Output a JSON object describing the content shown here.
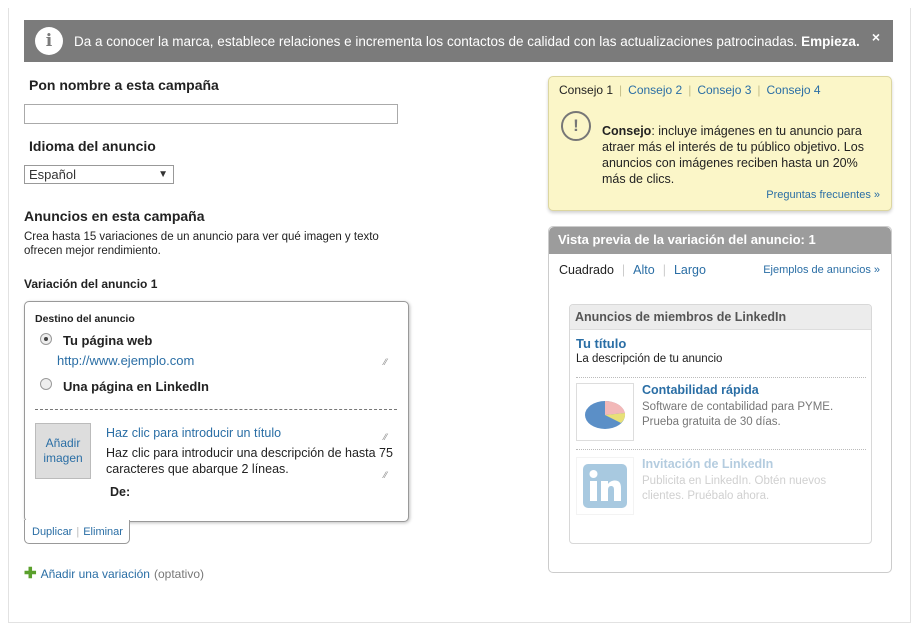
{
  "banner": {
    "message": "Da a conocer la marca, establece relaciones e incrementa los contactos de calidad con las actualizaciones patrocinadas.",
    "cta": "Empieza.",
    "close": "×"
  },
  "form": {
    "name_label": "Pon nombre a esta campaña",
    "name_value": "",
    "language_label": "Idioma del anuncio",
    "language_value": "Español",
    "ads_title": "Anuncios en esta campaña",
    "ads_desc": "Crea hasta 15 variaciones de un anuncio para ver qué imagen y texto ofrecen mejor rendimiento."
  },
  "variation": {
    "title": "Variación del anuncio 1",
    "destination_label": "Destino del anuncio",
    "option_web": "Tu página web",
    "url_value": "http://www.ejemplo.com",
    "option_linkedin": "Una página en LinkedIn",
    "add_image": "Añadir imagen",
    "title_placeholder": "Haz clic para introducir un título",
    "desc_placeholder": "Haz clic para introducir una descripción de hasta 75 caracteres que abarque 2 líneas.",
    "from_label": "De:",
    "duplicate": "Duplicar",
    "delete": "Eliminar"
  },
  "add_variation": {
    "label": "Añadir una variación",
    "optional": "(optativo)"
  },
  "tips": {
    "tabs": [
      "Consejo 1",
      "Consejo 2",
      "Consejo 3",
      "Consejo 4"
    ],
    "label": "Consejo",
    "text": ": incluye imágenes en tu anuncio para atraer más el interés de tu público objetivo. Los anuncios con imágenes reciben hasta un 20% más de clics.",
    "faq": "Preguntas frecuentes »"
  },
  "preview": {
    "header": "Vista previa de la variación del anuncio: 1",
    "sizes": [
      "Cuadrado",
      "Alto",
      "Largo"
    ],
    "examples": "Ejemplos de anuncios »",
    "members_header": "Anuncios de miembros de LinkedIn",
    "ad_title": "Tu título",
    "ad_desc": "La descripción de tu anuncio",
    "samples": [
      {
        "title": "Contabilidad rápida",
        "desc": "Software de contabilidad para PYME. Prueba gratuita de 30 días.",
        "icon": "pie-chart-icon"
      },
      {
        "title": "Invitación de LinkedIn",
        "desc": "Publicita en LinkedIn. Obtén nuevos clientes. Pruébalo ahora.",
        "icon": "linkedin-logo-icon"
      }
    ]
  },
  "colors": {
    "banner_bg": "#7b7b7b",
    "link": "#2a6ea5",
    "tip_bg": "#fbf6c8",
    "preview_header": "#9c9c9c",
    "add_green": "#5aa02c"
  }
}
